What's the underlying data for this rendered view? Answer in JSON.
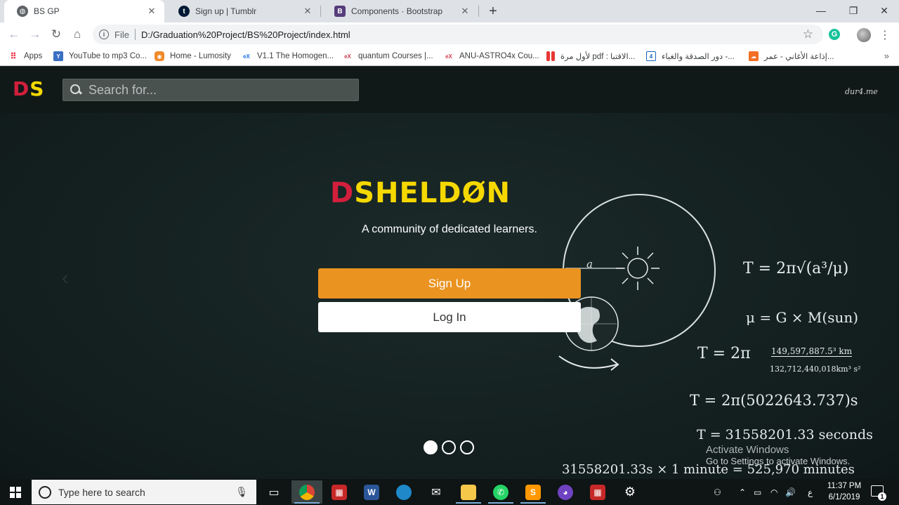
{
  "browser": {
    "tabs": [
      {
        "title": "BS GP",
        "active": true,
        "icon": "globe-icon"
      },
      {
        "title": "Sign up | Tumblr",
        "active": false,
        "icon": "tumblr-icon"
      },
      {
        "title": "Components · Bootstrap",
        "active": false,
        "icon": "bootstrap-icon"
      }
    ],
    "address": {
      "scheme_label": "File",
      "url": "D:/Graduation%20Project/BS%20Project/index.html"
    },
    "extension_letter": "G",
    "bookmarks": [
      {
        "label": "Apps",
        "icon": "apps-grid-icon"
      },
      {
        "label": "YouTube to mp3 Co...",
        "icon": "youtube-mp3-icon"
      },
      {
        "label": "Home - Lumosity",
        "icon": "lumosity-icon"
      },
      {
        "label": "V1.1 The Homogen...",
        "icon": "openedx-icon"
      },
      {
        "label": "quantum Courses |...",
        "icon": "edx-icon"
      },
      {
        "label": "ANU-ASTRO4x Cou...",
        "icon": "edx-icon"
      },
      {
        "label": "لأول مرة pdf : الاقتبا...",
        "icon": "bookmark-red-icon"
      },
      {
        "label": "دور الصدقة والغباء -...",
        "icon": "bookmark-4-icon"
      },
      {
        "label": "إذاعة الأغاني - عمر...",
        "icon": "soundcloud-icon"
      }
    ]
  },
  "site": {
    "logo": {
      "d": "D",
      "s": "S"
    },
    "search_placeholder": "Search for...",
    "header_mark": "dur4.me",
    "brand": {
      "d": "D",
      "rest": "SHELDØN"
    },
    "tagline": "A community of dedicated learners.",
    "signup_label": "Sign Up",
    "login_label": "Log In",
    "carousel": {
      "slides": 3,
      "active_index": 0
    }
  },
  "chalkboard": {
    "eq1": "T = 2π√(a³/μ)",
    "eq2": "μ = G × M(sun)",
    "eq3_num": "149,597,887.5³ km",
    "eq3_den": "132,712,440,018km³ s²",
    "eq3_prefix": "T = 2π",
    "eq4": "T = 2π(5022643.737)s",
    "eq5": "T = 31558201.33 seconds",
    "eq6": "31558201.33s  ×  1 minute   = 525,970 minutes",
    "label_a": "a"
  },
  "windows_activation": {
    "title": "Activate Windows",
    "subtitle": "Go to Settings to activate Windows."
  },
  "taskbar": {
    "search_placeholder": "Type here to search",
    "language": "ع",
    "time": "11:37 PM",
    "date": "6/1/2019",
    "notification_count": "1"
  }
}
